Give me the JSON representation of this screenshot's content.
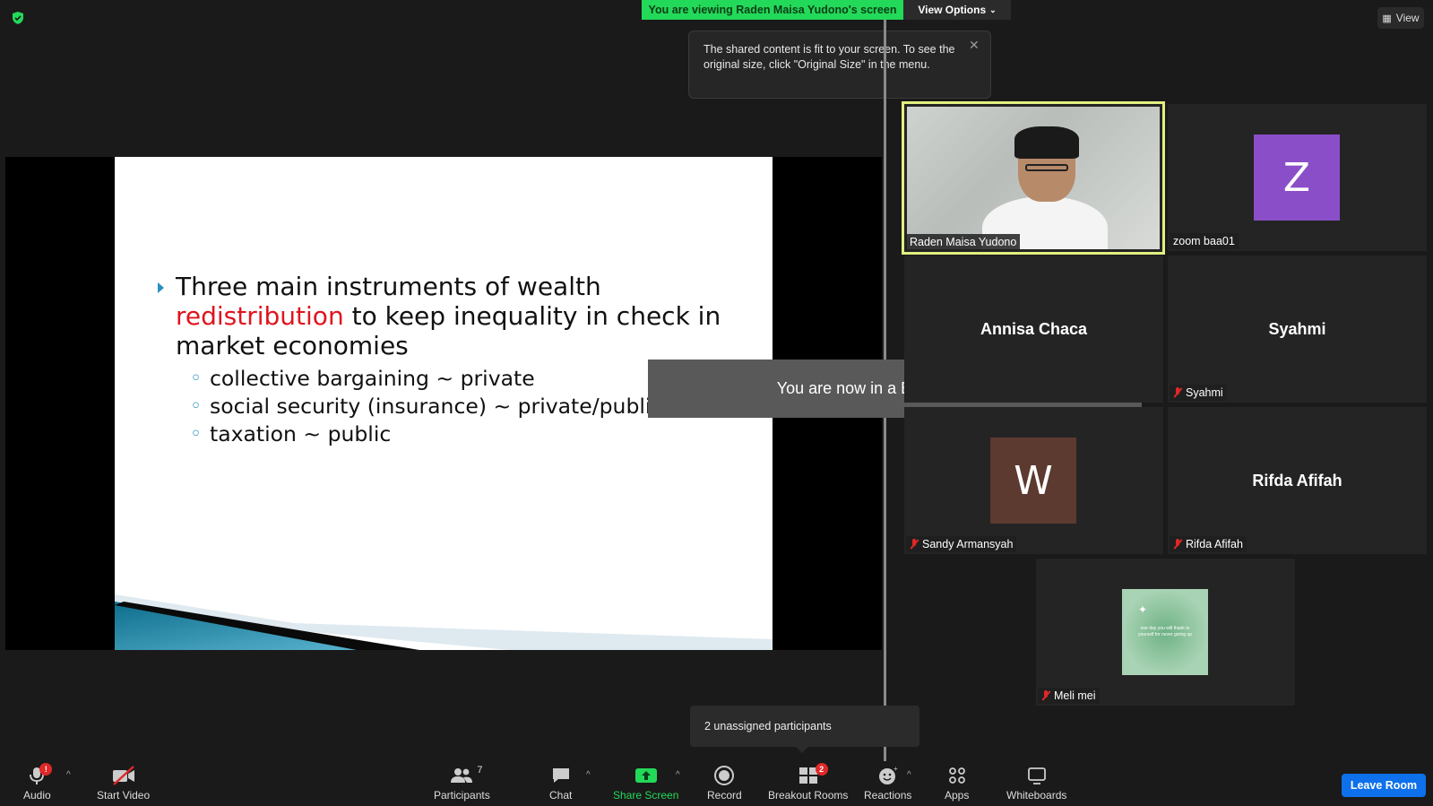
{
  "top": {
    "banner_text": "You are viewing Raden Maisa Yudono's screen",
    "view_options_label": "View Options",
    "view_label": "View"
  },
  "tooltip": {
    "text": "The shared content is fit to your screen. To see the original size, click \"Original Size\" in the menu."
  },
  "slide": {
    "line1": "Three main instruments of wealth",
    "line2_red": "redistribution",
    "line2_rest": " to keep inequality in check in",
    "line3": "market economies",
    "subs": [
      "collective bargaining ~ private",
      "social security (insurance) ~ private/public",
      "taxation ~ public"
    ]
  },
  "toast": "You are now in a Breakout Room",
  "participants": {
    "raden": "Raden Maisa Yudono",
    "zoom": "zoom baa01",
    "zoom_avatar": "Z",
    "annisa": "Annisa Chaca",
    "syahmi_big": "Syahmi",
    "syahmi": "Syahmi",
    "sandy_avatar": "W",
    "sandy": "Sandy Armansyah",
    "rifda_big": "Rifda Afifah",
    "rifda": "Rifda Afifah",
    "meli": "Meli mei",
    "meli_img_text": "one day you will thank to yourself for never giving up"
  },
  "unassigned": "2 unassigned participants",
  "toolbar": {
    "audio": "Audio",
    "audio_badge": "!",
    "start_video": "Start Video",
    "participants": "Participants",
    "participants_count": "7",
    "chat": "Chat",
    "share_screen": "Share Screen",
    "record": "Record",
    "breakout_rooms": "Breakout Rooms",
    "breakout_badge": "2",
    "reactions": "Reactions",
    "apps": "Apps",
    "whiteboards": "Whiteboards",
    "leave_room": "Leave Room"
  },
  "colors": {
    "accent_green": "#23d959",
    "active_speaker": "#e2ef80",
    "zoom_avatar_bg": "#8a4fc8",
    "sandy_avatar_bg": "#5c3a30",
    "leave_blue": "#0e71eb"
  }
}
